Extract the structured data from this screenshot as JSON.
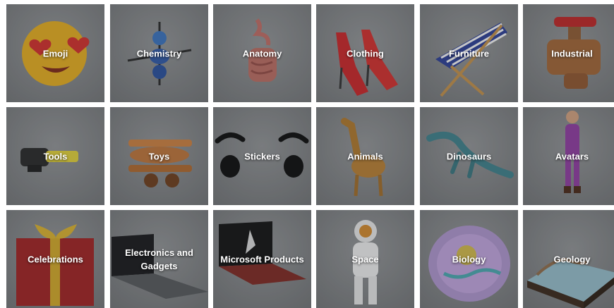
{
  "categories": [
    {
      "label": "Emoji",
      "icon": "heart-eyes-emoji-icon"
    },
    {
      "label": "Chemistry",
      "icon": "molecule-icon"
    },
    {
      "label": "Anatomy",
      "icon": "digestive-system-icon"
    },
    {
      "label": "Clothing",
      "icon": "high-heels-icon"
    },
    {
      "label": "Furniture",
      "icon": "beach-chair-icon"
    },
    {
      "label": "Industrial",
      "icon": "valve-icon"
    },
    {
      "label": "Tools",
      "icon": "drill-icon"
    },
    {
      "label": "Toys",
      "icon": "toy-plane-icon"
    },
    {
      "label": "Stickers",
      "icon": "cartoon-eyes-icon"
    },
    {
      "label": "Animals",
      "icon": "giraffe-icon"
    },
    {
      "label": "Dinosaurs",
      "icon": "plesiosaur-icon"
    },
    {
      "label": "Avatars",
      "icon": "avatar-figure-icon"
    },
    {
      "label": "Celebrations",
      "icon": "gift-box-icon"
    },
    {
      "label": "Electronics and Gadgets",
      "icon": "laptop-icon"
    },
    {
      "label": "Microsoft Products",
      "icon": "surface-laptop-icon"
    },
    {
      "label": "Space",
      "icon": "astronaut-icon"
    },
    {
      "label": "Biology",
      "icon": "cell-icon"
    },
    {
      "label": "Geology",
      "icon": "terrain-block-icon"
    }
  ]
}
